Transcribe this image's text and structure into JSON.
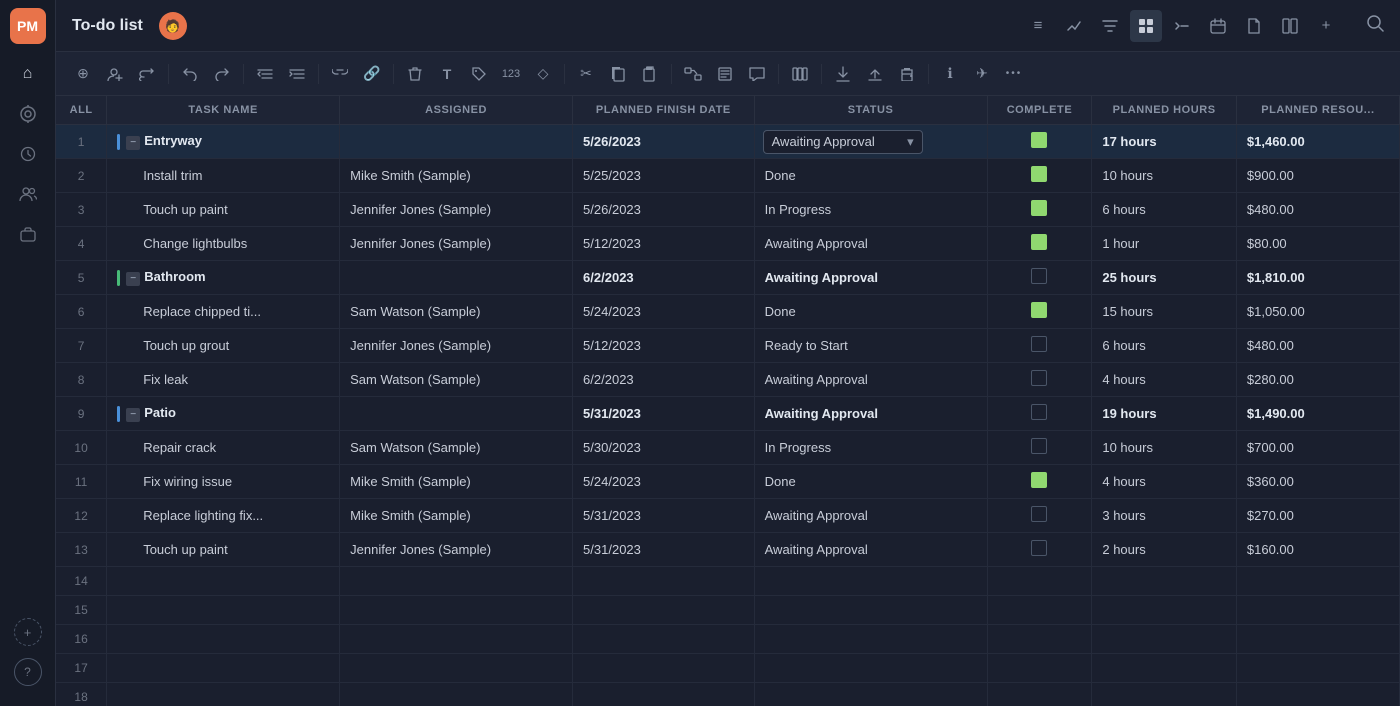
{
  "app": {
    "title": "To-do list",
    "avatar_emoji": "🧑",
    "search_icon": "🔍"
  },
  "sidebar": {
    "logo": "PM",
    "items": [
      {
        "name": "home",
        "icon": "⌂",
        "active": false
      },
      {
        "name": "notifications",
        "icon": "🔔",
        "active": false
      },
      {
        "name": "history",
        "icon": "🕐",
        "active": false
      },
      {
        "name": "people",
        "icon": "👥",
        "active": false
      },
      {
        "name": "briefcase",
        "icon": "💼",
        "active": false
      }
    ],
    "add_label": "+",
    "help_icon": "?"
  },
  "toolbar_icons": [
    {
      "name": "add",
      "icon": "⊕"
    },
    {
      "name": "add-user",
      "icon": "👤+"
    },
    {
      "name": "replace",
      "icon": "⇄"
    },
    {
      "name": "undo",
      "icon": "↩"
    },
    {
      "name": "redo",
      "icon": "↪"
    },
    {
      "name": "indent-left",
      "icon": "⇤"
    },
    {
      "name": "indent-right",
      "icon": "⇥"
    },
    {
      "name": "link",
      "icon": "🔗"
    },
    {
      "name": "unlink",
      "icon": "⛓"
    },
    {
      "name": "delete",
      "icon": "🗑"
    },
    {
      "name": "text",
      "icon": "T"
    },
    {
      "name": "tag",
      "icon": "🏷"
    },
    {
      "name": "number",
      "icon": "123"
    },
    {
      "name": "diamond",
      "icon": "◇"
    },
    {
      "name": "cut",
      "icon": "✂"
    },
    {
      "name": "copy",
      "icon": "⧉"
    },
    {
      "name": "paste-special",
      "icon": "📋"
    },
    {
      "name": "more1",
      "icon": "⚡"
    },
    {
      "name": "copy2",
      "icon": "📄"
    },
    {
      "name": "comment",
      "icon": "💬"
    },
    {
      "name": "grid",
      "icon": "⊞"
    },
    {
      "name": "export1",
      "icon": "↑"
    },
    {
      "name": "export2",
      "icon": "↗"
    },
    {
      "name": "print",
      "icon": "🖨"
    },
    {
      "name": "info",
      "icon": "ℹ"
    },
    {
      "name": "share",
      "icon": "✈"
    },
    {
      "name": "more",
      "icon": "•••"
    }
  ],
  "view_tabs": [
    {
      "name": "list-view",
      "icon": "≡",
      "active": false
    },
    {
      "name": "chart-view",
      "icon": "⚡",
      "active": false
    },
    {
      "name": "filter-view",
      "icon": "≣",
      "active": false
    },
    {
      "name": "grid-view",
      "icon": "⊟",
      "active": true
    },
    {
      "name": "gantt-view",
      "icon": "✓⎯",
      "active": false
    },
    {
      "name": "calendar-view",
      "icon": "📅",
      "active": false
    },
    {
      "name": "file-view",
      "icon": "📄",
      "active": false
    },
    {
      "name": "split-view",
      "icon": "⊡",
      "active": false
    },
    {
      "name": "add-view",
      "icon": "+",
      "active": false
    }
  ],
  "table": {
    "columns": [
      "ALL",
      "TASK NAME",
      "ASSIGNED",
      "PLANNED FINISH DATE",
      "STATUS",
      "COMPLETE",
      "PLANNED HOURS",
      "PLANNED RESOU..."
    ],
    "rows": [
      {
        "num": "1",
        "type": "group",
        "name": "Entryway",
        "assigned": "",
        "date": "5/26/2023",
        "status": "Awaiting Approval",
        "status_dropdown": true,
        "complete": "checked",
        "hours": "17 hours",
        "resources": "$1,460.00",
        "bold": true,
        "color": "blue"
      },
      {
        "num": "2",
        "type": "task",
        "name": "Install trim",
        "assigned": "Mike Smith (Sample)",
        "date": "5/25/2023",
        "status": "Done",
        "complete": "checked",
        "hours": "10 hours",
        "resources": "$900.00",
        "color": "blue"
      },
      {
        "num": "3",
        "type": "task",
        "name": "Touch up paint",
        "assigned": "Jennifer Jones (Sample)",
        "date": "5/26/2023",
        "status": "In Progress",
        "complete": "checked",
        "hours": "6 hours",
        "resources": "$480.00",
        "color": "blue"
      },
      {
        "num": "4",
        "type": "task",
        "name": "Change lightbulbs",
        "assigned": "Jennifer Jones (Sample)",
        "date": "5/12/2023",
        "status": "Awaiting Approval",
        "complete": "checked",
        "hours": "1 hour",
        "resources": "$80.00",
        "color": "blue"
      },
      {
        "num": "5",
        "type": "group",
        "name": "Bathroom",
        "assigned": "",
        "date": "6/2/2023",
        "status": "Awaiting Approval",
        "complete": "unchecked",
        "hours": "25 hours",
        "resources": "$1,810.00",
        "bold": true,
        "color": "green"
      },
      {
        "num": "6",
        "type": "task",
        "name": "Replace chipped ti...",
        "assigned": "Sam Watson (Sample)",
        "date": "5/24/2023",
        "status": "Done",
        "complete": "checked",
        "hours": "15 hours",
        "resources": "$1,050.00",
        "color": "green"
      },
      {
        "num": "7",
        "type": "task",
        "name": "Touch up grout",
        "assigned": "Jennifer Jones (Sample)",
        "date": "5/12/2023",
        "status": "Ready to Start",
        "complete": "unchecked",
        "hours": "6 hours",
        "resources": "$480.00",
        "color": "green"
      },
      {
        "num": "8",
        "type": "task",
        "name": "Fix leak",
        "assigned": "Sam Watson (Sample)",
        "date": "6/2/2023",
        "status": "Awaiting Approval",
        "complete": "unchecked",
        "hours": "4 hours",
        "resources": "$280.00",
        "color": "green"
      },
      {
        "num": "9",
        "type": "group",
        "name": "Patio",
        "assigned": "",
        "date": "5/31/2023",
        "status": "Awaiting Approval",
        "complete": "unchecked",
        "hours": "19 hours",
        "resources": "$1,490.00",
        "bold": true,
        "color": "blue"
      },
      {
        "num": "10",
        "type": "task",
        "name": "Repair crack",
        "assigned": "Sam Watson (Sample)",
        "date": "5/30/2023",
        "status": "In Progress",
        "complete": "unchecked",
        "hours": "10 hours",
        "resources": "$700.00",
        "color": "blue"
      },
      {
        "num": "11",
        "type": "task",
        "name": "Fix wiring issue",
        "assigned": "Mike Smith (Sample)",
        "date": "5/24/2023",
        "status": "Done",
        "complete": "checked",
        "hours": "4 hours",
        "resources": "$360.00",
        "color": "blue"
      },
      {
        "num": "12",
        "type": "task",
        "name": "Replace lighting fix...",
        "assigned": "Mike Smith (Sample)",
        "date": "5/31/2023",
        "status": "Awaiting Approval",
        "complete": "unchecked",
        "hours": "3 hours",
        "resources": "$270.00",
        "color": "blue"
      },
      {
        "num": "13",
        "type": "task",
        "name": "Touch up paint",
        "assigned": "Jennifer Jones (Sample)",
        "date": "5/31/2023",
        "status": "Awaiting Approval",
        "complete": "unchecked",
        "hours": "2 hours",
        "resources": "$160.00",
        "color": "blue"
      },
      {
        "num": "14",
        "type": "empty"
      },
      {
        "num": "15",
        "type": "empty"
      },
      {
        "num": "16",
        "type": "empty"
      },
      {
        "num": "17",
        "type": "empty"
      },
      {
        "num": "18",
        "type": "empty"
      }
    ]
  },
  "status_dropdown_selected": "Awaiting Approval"
}
